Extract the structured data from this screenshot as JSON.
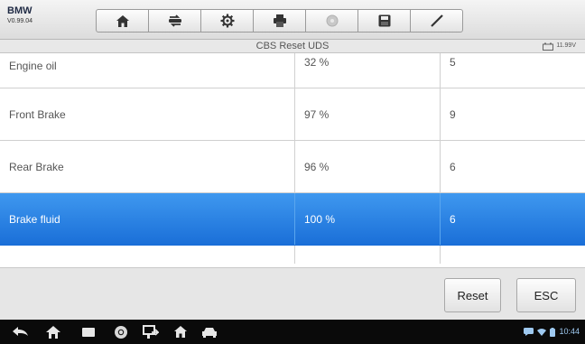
{
  "header": {
    "brand": "BMW",
    "version": "V0.99.04",
    "tools": [
      {
        "icon": "home-icon"
      },
      {
        "icon": "vehicle-swap-icon"
      },
      {
        "icon": "gear-icon"
      },
      {
        "icon": "print-icon"
      },
      {
        "icon": "help-icon",
        "disabled": true
      },
      {
        "icon": "save-icon"
      },
      {
        "icon": "edit-icon"
      }
    ]
  },
  "titlebar": {
    "title": "CBS Reset UDS",
    "battery_voltage": "11.99V"
  },
  "table": {
    "rows": [
      {
        "name": "Engine oil",
        "percent": "32 %",
        "count": "5"
      },
      {
        "name": "Front Brake",
        "percent": "97 %",
        "count": "9"
      },
      {
        "name": "Rear Brake",
        "percent": "96 %",
        "count": "6"
      },
      {
        "name": "Brake fluid",
        "percent": "100 %",
        "count": "6",
        "selected": true
      }
    ]
  },
  "buttons": {
    "reset": "Reset",
    "esc": "ESC"
  },
  "navbar": {
    "icons": [
      "back-icon",
      "home-icon",
      "recent-apps-icon",
      "chrome-icon",
      "screen-capture-icon",
      "autel-home-icon",
      "car-icon"
    ],
    "time": "10:44"
  },
  "colors": {
    "selected_row": "#2a85e8",
    "nav_background": "#0a0a0a"
  }
}
